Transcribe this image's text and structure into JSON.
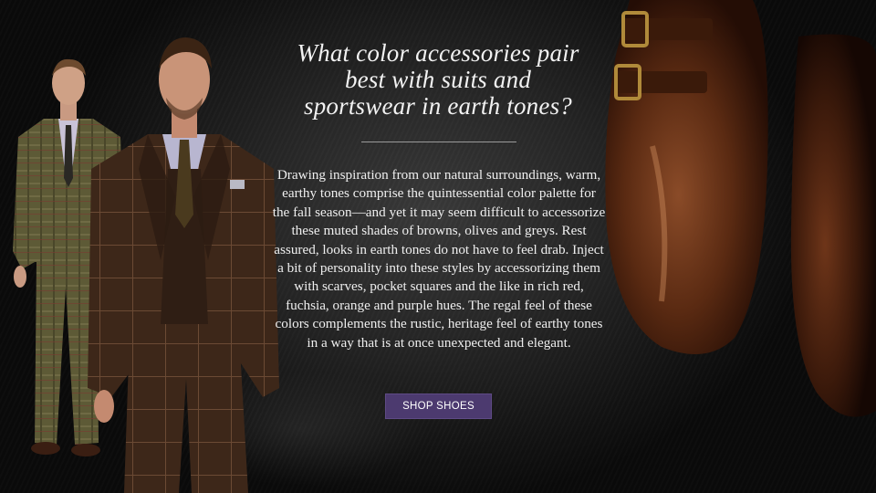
{
  "hero": {
    "heading": "What color accessories pair best with suits and sportswear in earth tones?",
    "body": "Drawing inspiration from our natural surroundings, warm, earthy tones comprise the quintessential color palette for the fall season—and yet it may seem difficult to accessorize these muted shades of browns, olives and greys. Rest assured, looks in earth tones do not have to feel drab. Inject a bit of personality into these styles by accessorizing them with scarves, pocket squares and the like in rich red, fuchsia, orange and purple hues. The regal feel of these colors complements the rustic, heritage feel of earthy tones in a way that is at once unexpected and elegant.",
    "cta_label": "SHOP SHOES"
  },
  "colors": {
    "cta_background": "#4c3a6f",
    "text": "#f2f2f2",
    "background": "#1a1a1a"
  },
  "images": {
    "models": "two-men-in-brown-and-plaid-suits",
    "shoes": "brown-double-monk-strap-shoes"
  }
}
